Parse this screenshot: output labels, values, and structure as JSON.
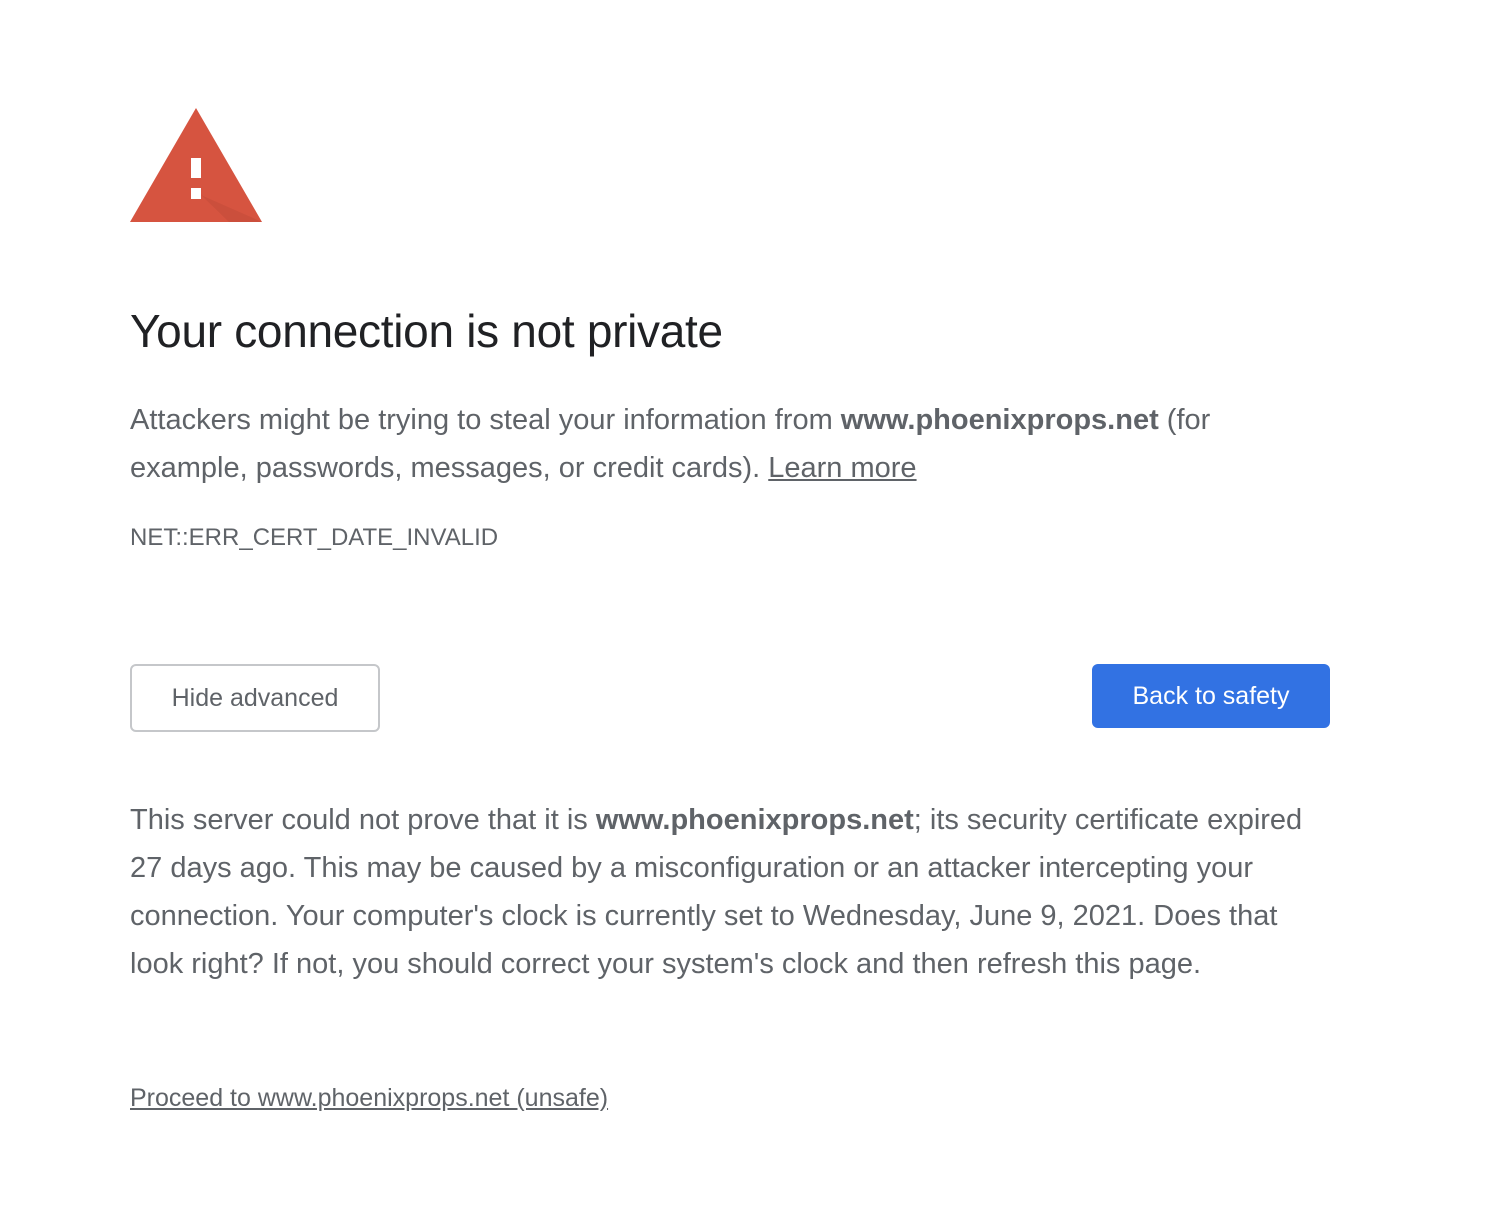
{
  "icon": {
    "name": "warning-triangle-icon",
    "color": "#d65440",
    "mark_color": "#ffffff"
  },
  "title": "Your connection is not private",
  "main_message": {
    "prefix": "Attackers might be trying to steal your information from ",
    "domain": "www.phoenixprops.net",
    "suffix": " (for example, passwords, messages, or credit cards). ",
    "learn_more": "Learn more"
  },
  "error_code": "NET::ERR_CERT_DATE_INVALID",
  "buttons": {
    "hide_advanced": "Hide advanced",
    "back_to_safety": "Back to safety",
    "primary_color": "#3272e3"
  },
  "details": {
    "prefix": "This server could not prove that it is ",
    "domain": "www.phoenixprops.net",
    "suffix": "; its security certificate expired 27 days ago. This may be caused by a misconfiguration or an attacker intercepting your connection. Your computer's clock is currently set to Wednesday, June 9, 2021. Does that look right? If not, you should correct your system's clock and then refresh this page."
  },
  "proceed_link": "Proceed to www.phoenixprops.net (unsafe)"
}
